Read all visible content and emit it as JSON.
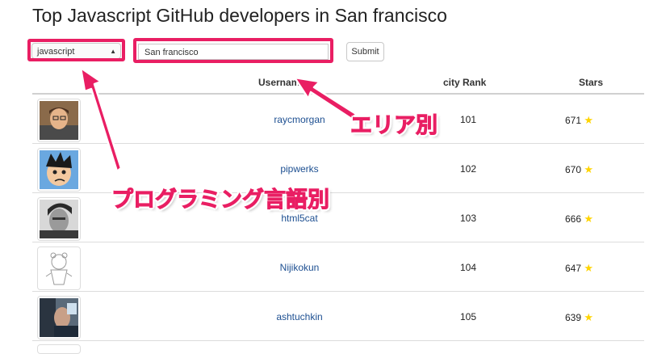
{
  "page": {
    "title": "Top Javascript GitHub developers in San francisco"
  },
  "controls": {
    "language_select": {
      "value": "javascript"
    },
    "city_input": {
      "value": "San francisco"
    },
    "submit_label": "Submit"
  },
  "table": {
    "headers": {
      "username": "Usernam",
      "city_rank": "city Rank",
      "stars": "Stars"
    },
    "rows": [
      {
        "username": "raycmorgan",
        "rank": "101",
        "stars": "671"
      },
      {
        "username": "pipwerks",
        "rank": "102",
        "stars": "670"
      },
      {
        "username": "html5cat",
        "rank": "103",
        "stars": "666"
      },
      {
        "username": "Nijikokun",
        "rank": "104",
        "stars": "647"
      },
      {
        "username": "ashtuchkin",
        "rank": "105",
        "stars": "639"
      }
    ]
  },
  "annotations": {
    "area_label": "エリア別",
    "language_label": "プログラミング言語別",
    "color": "#e91e63"
  },
  "icons": {
    "star": "star-icon",
    "chevron": "select-chevron-icon"
  }
}
